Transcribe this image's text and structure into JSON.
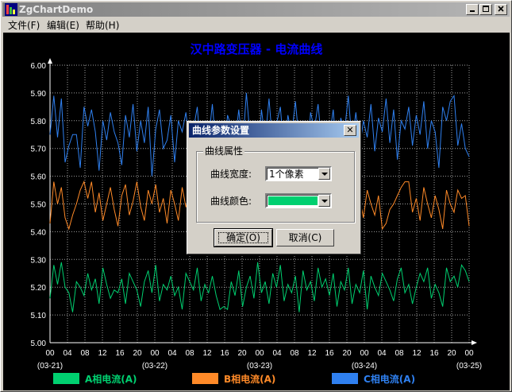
{
  "window": {
    "title": "ZgChartDemo"
  },
  "menu": [
    {
      "label": "文件(F)"
    },
    {
      "label": "编辑(E)"
    },
    {
      "label": "帮助(H)"
    }
  ],
  "colors": {
    "phase_a": "#00d070",
    "phase_b": "#ff8a28",
    "phase_c": "#2f80f0",
    "title": "#0000ff",
    "text": "#ffffff"
  },
  "chart_data": {
    "type": "line",
    "title": "汉中路变压器 - 电流曲线",
    "ylim": [
      5.0,
      6.0
    ],
    "y_ticks": [
      "5.00",
      "5.10",
      "5.20",
      "5.30",
      "5.40",
      "5.50",
      "5.60",
      "5.70",
      "5.80",
      "5.90",
      "6.00"
    ],
    "x_ticks": [
      "00",
      "04",
      "08",
      "12",
      "16",
      "20",
      "00",
      "04",
      "08",
      "12",
      "16",
      "20",
      "00",
      "04",
      "08",
      "12",
      "16",
      "20",
      "00",
      "04",
      "08",
      "12",
      "16",
      "20",
      "00"
    ],
    "x_dates": [
      "(03-21)",
      "(03-22)",
      "(03-23)",
      "(03-24)",
      "(03-25)"
    ],
    "grid": true,
    "legend_position": "bottom",
    "series": [
      {
        "name": "A相电流(A)",
        "values": [
          5.16,
          5.28,
          5.21,
          5.29,
          5.2,
          5.18,
          5.11,
          5.22,
          5.2,
          5.17,
          5.25,
          5.19,
          5.23,
          5.14,
          5.27,
          5.21,
          5.16,
          5.19,
          5.18,
          5.23,
          5.14,
          5.25,
          5.22,
          5.19,
          5.13,
          5.22,
          5.26,
          5.18,
          5.28,
          5.15,
          5.21,
          5.19,
          5.24,
          5.17,
          5.2,
          5.12,
          5.25,
          5.22,
          5.19,
          5.27,
          5.15,
          5.21,
          5.18,
          5.24,
          5.17,
          5.12,
          5.13,
          5.12,
          5.22,
          5.17,
          5.26,
          5.13,
          5.2,
          5.24,
          5.16,
          5.29,
          5.18,
          5.22,
          5.14,
          5.25,
          5.2,
          5.28,
          5.15,
          5.21,
          5.18,
          5.24,
          5.11,
          5.26,
          5.19,
          5.22,
          5.15,
          5.27,
          5.2,
          5.23,
          5.17,
          5.25,
          5.13,
          5.22,
          5.19,
          5.27,
          5.14,
          5.21,
          5.18,
          5.26,
          5.12,
          5.24,
          5.2,
          5.17,
          5.25,
          5.22,
          5.19,
          5.15,
          5.23,
          5.27,
          5.18,
          5.21,
          5.14,
          5.2,
          5.25,
          5.22,
          5.27,
          5.16,
          5.21,
          5.18,
          5.13,
          5.27,
          5.22,
          5.24,
          5.2,
          5.28,
          5.26,
          5.22
        ]
      },
      {
        "name": "B相电流(A)",
        "values": [
          5.43,
          5.58,
          5.5,
          5.56,
          5.45,
          5.41,
          5.46,
          5.5,
          5.55,
          5.58,
          5.52,
          5.58,
          5.47,
          5.54,
          5.44,
          5.5,
          5.56,
          5.48,
          5.42,
          5.53,
          5.57,
          5.46,
          5.51,
          5.58,
          5.49,
          5.44,
          5.55,
          5.5,
          5.57,
          5.47,
          5.52,
          5.43,
          5.55,
          5.5,
          5.44,
          5.56,
          5.49,
          5.52,
          5.46,
          5.54,
          5.42,
          5.51,
          5.57,
          5.48,
          5.53,
          5.45,
          5.55,
          5.5,
          5.47,
          5.52,
          5.58,
          5.44,
          5.51,
          5.56,
          5.46,
          5.53,
          5.49,
          5.57,
          5.43,
          5.52,
          5.5,
          5.55,
          5.45,
          5.54,
          5.48,
          5.57,
          5.42,
          5.51,
          5.55,
          5.47,
          5.52,
          5.44,
          5.56,
          5.5,
          5.53,
          5.46,
          5.55,
          5.49,
          5.51,
          5.44,
          5.57,
          5.48,
          5.52,
          5.45,
          5.55,
          5.5,
          5.46,
          5.53,
          5.41,
          5.43,
          5.48,
          5.5,
          5.53,
          5.56,
          5.58,
          5.58,
          5.47,
          5.52,
          5.44,
          5.56,
          5.5,
          5.45,
          5.53,
          5.48,
          5.41,
          5.55,
          5.5,
          5.47,
          5.55,
          5.52,
          5.53,
          5.42
        ]
      },
      {
        "name": "C相电流(A)",
        "values": [
          5.75,
          5.89,
          5.74,
          5.88,
          5.65,
          5.71,
          5.75,
          5.75,
          5.63,
          5.85,
          5.78,
          5.84,
          5.76,
          5.62,
          5.8,
          5.73,
          5.83,
          5.76,
          5.72,
          5.64,
          5.82,
          5.74,
          5.86,
          5.69,
          5.8,
          5.72,
          5.85,
          5.6,
          5.77,
          5.84,
          5.7,
          5.73,
          5.82,
          5.65,
          5.8,
          5.76,
          5.83,
          5.71,
          5.77,
          5.85,
          5.68,
          5.8,
          5.73,
          5.86,
          5.7,
          5.75,
          5.62,
          5.82,
          5.78,
          5.72,
          5.84,
          5.7,
          5.9,
          5.74,
          5.8,
          5.66,
          5.84,
          5.73,
          5.88,
          5.71,
          5.79,
          5.85,
          5.68,
          5.82,
          5.75,
          5.87,
          5.72,
          5.8,
          5.63,
          5.83,
          5.77,
          5.86,
          5.71,
          5.8,
          5.74,
          5.84,
          5.67,
          5.81,
          5.76,
          5.89,
          5.72,
          5.83,
          5.7,
          5.8,
          5.74,
          5.86,
          5.69,
          5.81,
          5.76,
          5.88,
          5.72,
          5.84,
          5.66,
          5.8,
          5.77,
          5.85,
          5.71,
          5.82,
          5.75,
          5.87,
          5.7,
          5.8,
          5.76,
          5.63,
          5.85,
          5.8,
          5.87,
          5.89,
          5.71,
          5.79,
          5.7,
          5.67
        ]
      }
    ]
  },
  "dialog": {
    "title": "曲线参数设置",
    "close_glyph": "✕",
    "group_label": "曲线属性",
    "width_label": "曲线宽度:",
    "width_value": "1个像素",
    "color_label": "曲线颜色:",
    "color_value": "#00d070",
    "ok_label": "确定(O)",
    "cancel_label": "取消(C)"
  }
}
